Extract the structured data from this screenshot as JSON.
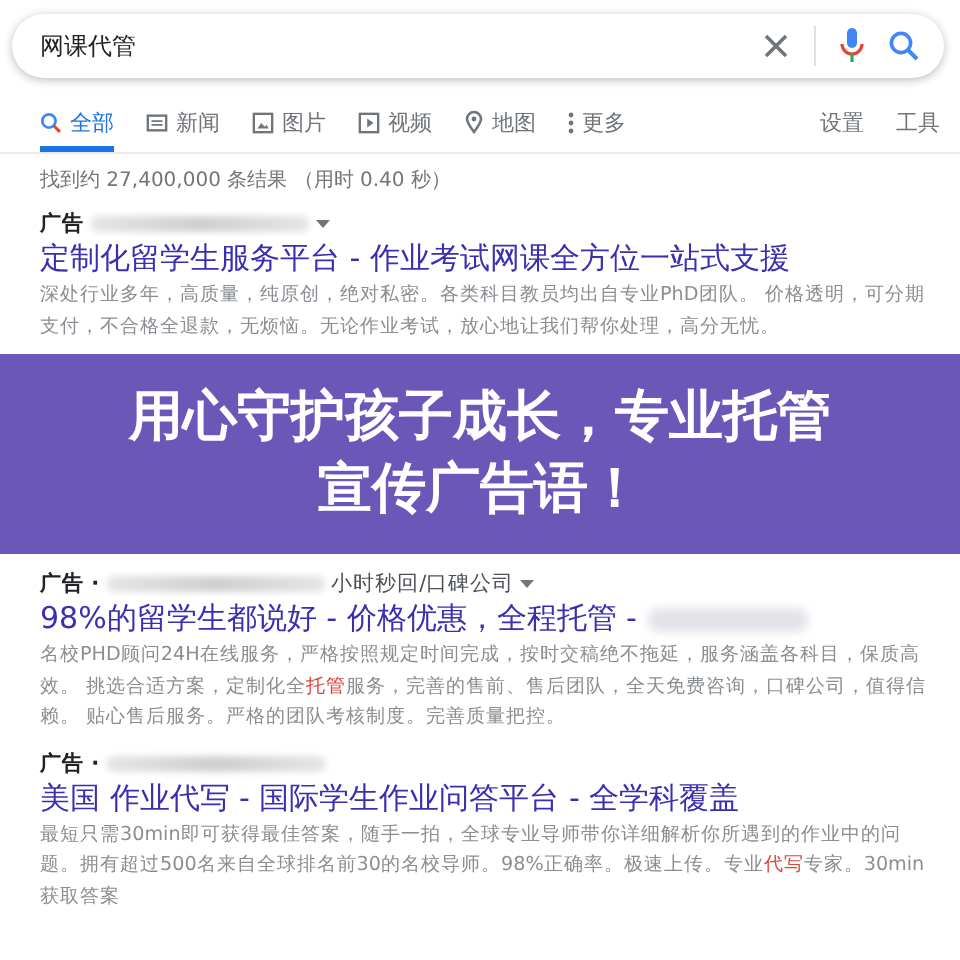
{
  "search": {
    "value": "网课代管"
  },
  "tabs": [
    {
      "label": "全部",
      "selected": true
    },
    {
      "label": "新闻",
      "selected": false
    },
    {
      "label": "图片",
      "selected": false
    },
    {
      "label": "视频",
      "selected": false
    },
    {
      "label": "地图",
      "selected": false
    },
    {
      "label": "更多",
      "selected": false
    }
  ],
  "tools": [
    "设置",
    "工具"
  ],
  "result_stats": "找到约 27,400,000 条结果 （用时 0.40 秒）",
  "results": [
    {
      "ad_label": "广告",
      "title": "定制化留学生服务平台 - 作业考试网课全方位一站式支援",
      "title_blurred": false,
      "description": [
        {
          "text": "深处行业多年，高质量，纯原创，绝对私密。各类科目教员均出自专业PhD团队。 价格透明，可分期支付，不合格全退款，无烦恼。无论作业考试，放心地让我们帮你处理，高分无忧。",
          "highlight": false
        }
      ]
    },
    {
      "ad_label": "广告 ·",
      "url_tail": "小时秒回/口碑公司",
      "title": "98%的留学生都说好 - 价格优惠，全程托管 -",
      "title_blurred": true,
      "description": [
        {
          "text": "名校PHD顾问24H在线服务，严格按照规定时间完成，按时交稿绝不拖延，服务涵盖各科目，保质高效。 挑选合适方案，定制化全",
          "highlight": false
        },
        {
          "text": "托管",
          "highlight": true
        },
        {
          "text": "服务，完善的售前、售后团队，全天免费咨询，口碑公司，值得信赖。 贴心售后服务。严格的团队考核制度。完善质量把控。",
          "highlight": false
        }
      ]
    },
    {
      "ad_label": "广告 ·",
      "title": "美国 作业代写 - 国际学生作业问答平台 - 全学科覆盖",
      "title_blurred": false,
      "description": [
        {
          "text": "最短只需30min即可获得最佳答案，随手一拍，全球专业导师带你详细解析你所遇到的作业中的问题。拥有超过500名来自全球排名前30的名校导师。98%正确率。极速上传。专业",
          "highlight": false
        },
        {
          "text": "代写",
          "highlight": true
        },
        {
          "text": "专家。30min获取答案",
          "highlight": false
        }
      ]
    }
  ],
  "banner": {
    "lines": [
      "用心守护孩子成长，专业托管",
      "宣传广告语！"
    ]
  }
}
